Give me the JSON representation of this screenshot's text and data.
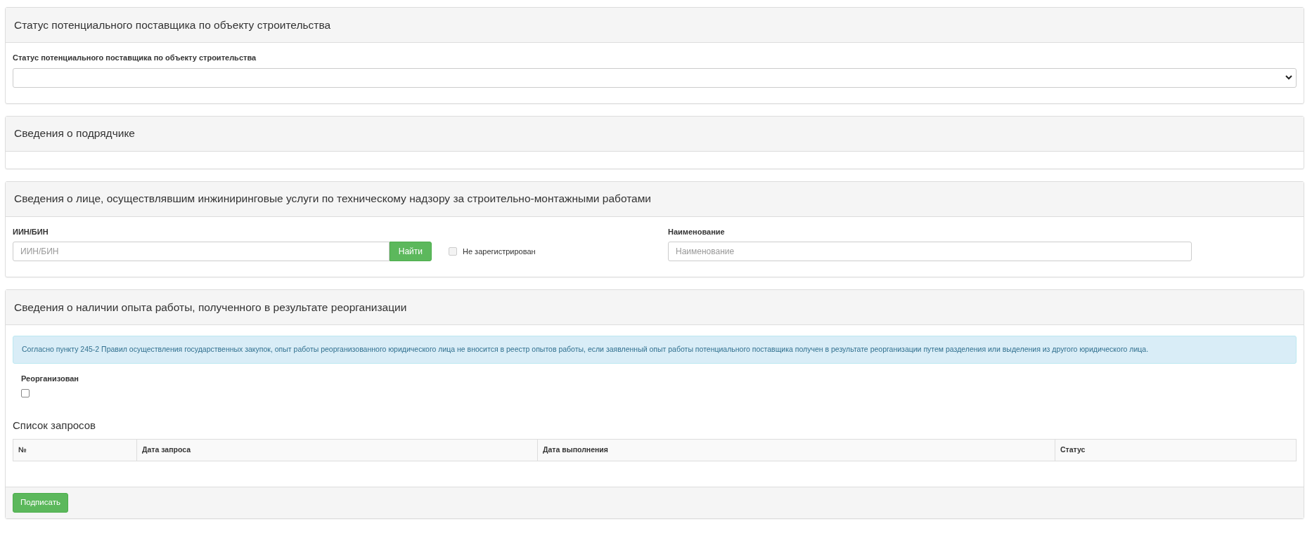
{
  "status_panel": {
    "title": "Статус потенциального поставщика по объекту строительства",
    "field_label": "Статус потенциального поставщика по объекту строительства"
  },
  "contractor_panel": {
    "title": "Сведения о подрядчике"
  },
  "engineer_panel": {
    "title": "Сведения о лице, осуществлявшим инжиниринговые услуги по техническому надзору за строительно-монтажными работами",
    "iin_label": "ИИН/БИН",
    "iin_placeholder": "ИИН/БИН",
    "find_button": "Найти",
    "not_registered": {
      "label": "Не зарегистрирован",
      "checked": false,
      "disabled": true
    },
    "name_label": "Наименование",
    "name_placeholder": "Наименование"
  },
  "reorg_panel": {
    "title": "Сведения о наличии опыта работы, полученного в результате реорганизации",
    "notice": "Согласно пункту 245-2 Правил осуществления государственных закупок, опыт работы реорганизованного юридического лица не вносится в реестр опытов работы, если заявленный опыт работы потенциального поставщика получен в результате реорганизации путем разделения или выделения из другого юридического лица.",
    "reorganized": {
      "label": "Реорганизован",
      "checked": false
    },
    "requests_title": "Список запросов",
    "table": {
      "columns": [
        "№",
        "Дата запроса",
        "Дата выполнения",
        "Статус"
      ]
    },
    "sign_button": "Подписать"
  }
}
